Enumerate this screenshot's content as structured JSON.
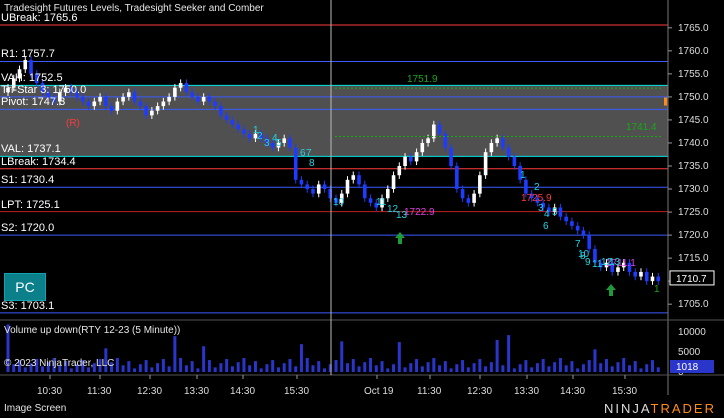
{
  "window": {
    "title": "Tradesight Futures Levels, Tradesight Seeker and Comber",
    "volume_title": "Volume up down(RTY 12-23 (5 Minute))",
    "copyright": "© 2023 NinjaTrader, LLC",
    "footer_left": "Image Screen",
    "logo_left": "NINJA",
    "logo_right": "TRADER"
  },
  "pc_button": {
    "label": "PC"
  },
  "levels": [
    {
      "label": "UBreak: 1765.6",
      "price": 1765.6,
      "color": "#ff3b3b"
    },
    {
      "label": "R1: 1757.7",
      "price": 1757.7,
      "color": "#3b5bff"
    },
    {
      "label": "VAH: 1752.5",
      "price": 1752.5,
      "color": "#00e5e5"
    },
    {
      "label": "Tri-Star 3: 1750.0",
      "price": 1750.0,
      "color": "#3b5bff"
    },
    {
      "label": "Pivot: 1747.3",
      "price": 1747.3,
      "color": "#3b5bff"
    },
    {
      "label": "VAL: 1737.1",
      "price": 1737.1,
      "color": "#00e5e5"
    },
    {
      "label": "LBreak: 1734.4",
      "price": 1734.4,
      "color": "#ff3b3b"
    },
    {
      "label": "S1: 1730.4",
      "price": 1730.4,
      "color": "#3b5bff"
    },
    {
      "label": "LPT: 1725.1",
      "price": 1725.1,
      "color": "#c21f1f"
    },
    {
      "label": "S2: 1720.0",
      "price": 1720.0,
      "color": "#3b5bff"
    },
    {
      "label": "S3: 1703.1",
      "price": 1703.1,
      "color": "#3b5bff"
    }
  ],
  "price_axis": {
    "ticks": [
      "1765.0",
      "1760.0",
      "1755.0",
      "1750.0",
      "1745.0",
      "1740.0",
      "1735.0",
      "1730.0",
      "1725.0",
      "1720.0",
      "1715.0",
      "1710.0",
      "1705.0"
    ],
    "tick_values": [
      1765,
      1760,
      1755,
      1750,
      1745,
      1740,
      1735,
      1730,
      1725,
      1720,
      1715,
      1710,
      1705
    ],
    "min": 1702.0,
    "max": 1768.0,
    "last_price": "1710.7",
    "last_value": 1710.7
  },
  "volume_axis": {
    "ticks": [
      "10000",
      "5000",
      "0"
    ],
    "tick_values": [
      10000,
      5000,
      0
    ],
    "max": 12500,
    "last_volume": "1018"
  },
  "time_axis": {
    "labels": [
      "10:30",
      "11:30",
      "12:30",
      "13:30",
      "14:30",
      "15:30",
      "Oct 19",
      "11:30",
      "12:30",
      "13:30",
      "14:30",
      "15:30"
    ],
    "session_break_index": 6
  },
  "annotations": {
    "value_area_high_prev": "1751.9",
    "value_area_low_prev": "1741.4",
    "r_marker": "(R)",
    "target_1": "1722.9",
    "target_2": "1725.9",
    "target_3": "1711.1",
    "seq_left": [
      "1",
      "2",
      "3",
      "4",
      "5",
      "6",
      "7",
      "8",
      "9"
    ],
    "seq_mid": [
      "10",
      "11",
      "12",
      "13"
    ],
    "seq_right": [
      "1",
      "2",
      "3",
      "4",
      "5",
      "6",
      "7",
      "8",
      "9",
      "10",
      "11",
      "12",
      "13"
    ],
    "seq_end": "1"
  },
  "colors": {
    "up_candle": "#ffffff",
    "down_candle": "#1e3cff",
    "volume_bar": "#2a36c9",
    "value_area": "#6b6b6b",
    "grid": "#1a1a1a",
    "accent_orange": "#ff8c1a"
  }
}
